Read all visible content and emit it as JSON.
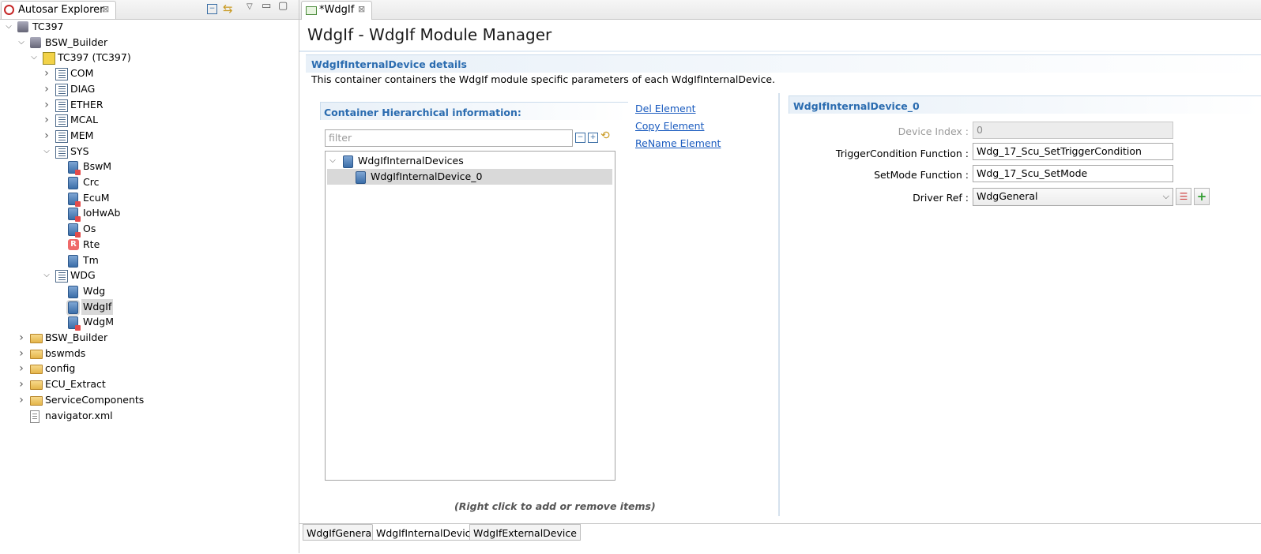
{
  "explorer": {
    "tab_label": "Autosar Explorer",
    "tree": [
      {
        "label": "TC397",
        "level": 0,
        "expanded": "open",
        "icon": "project-icon"
      },
      {
        "label": "BSW_Builder",
        "level": 1,
        "expanded": "open",
        "icon": "builder-icon"
      },
      {
        "label": "TC397 (TC397)",
        "level": 2,
        "expanded": "open",
        "icon": "ecu-chip-icon"
      },
      {
        "label": "COM",
        "level": 3,
        "expanded": "closed",
        "icon": "list-icon"
      },
      {
        "label": "DIAG",
        "level": 3,
        "expanded": "closed",
        "icon": "list-icon"
      },
      {
        "label": "ETHER",
        "level": 3,
        "expanded": "closed",
        "icon": "list-icon"
      },
      {
        "label": "MCAL",
        "level": 3,
        "expanded": "closed",
        "icon": "list-icon"
      },
      {
        "label": "MEM",
        "level": 3,
        "expanded": "closed",
        "icon": "list-icon"
      },
      {
        "label": "SYS",
        "level": 3,
        "expanded": "open",
        "icon": "list-icon"
      },
      {
        "label": "BswM",
        "level": 4,
        "expanded": "none",
        "icon": "module-red-icon"
      },
      {
        "label": "Crc",
        "level": 4,
        "expanded": "none",
        "icon": "module-icon"
      },
      {
        "label": "EcuM",
        "level": 4,
        "expanded": "none",
        "icon": "module-red-icon"
      },
      {
        "label": "IoHwAb",
        "level": 4,
        "expanded": "none",
        "icon": "module-red-icon"
      },
      {
        "label": "Os",
        "level": 4,
        "expanded": "none",
        "icon": "module-red-icon"
      },
      {
        "label": "Rte",
        "level": 4,
        "expanded": "none",
        "icon": "rte-icon"
      },
      {
        "label": "Tm",
        "level": 4,
        "expanded": "none",
        "icon": "module-icon"
      },
      {
        "label": "WDG",
        "level": 3,
        "expanded": "open",
        "icon": "list-icon"
      },
      {
        "label": "Wdg",
        "level": 4,
        "expanded": "none",
        "icon": "module-icon"
      },
      {
        "label": "WdgIf",
        "level": 4,
        "expanded": "none",
        "icon": "module-icon",
        "selected": true
      },
      {
        "label": "WdgM",
        "level": 4,
        "expanded": "none",
        "icon": "module-red-icon"
      },
      {
        "label": "BSW_Builder",
        "level": 1,
        "expanded": "closed",
        "icon": "folder-icon"
      },
      {
        "label": "bswmds",
        "level": 1,
        "expanded": "closed",
        "icon": "folder-icon"
      },
      {
        "label": "config",
        "level": 1,
        "expanded": "closed",
        "icon": "folder-icon"
      },
      {
        "label": "ECU_Extract",
        "level": 1,
        "expanded": "closed",
        "icon": "folder-icon"
      },
      {
        "label": "ServiceComponents",
        "level": 1,
        "expanded": "closed",
        "icon": "folder-icon"
      },
      {
        "label": "navigator.xml",
        "level": 1,
        "expanded": "none",
        "icon": "xml-file-icon"
      }
    ]
  },
  "editor": {
    "tab_label": "*WdgIf",
    "title": "WdgIf - WdgIf Module Manager",
    "section_title": "WdgIfInternalDevice details",
    "section_desc": "This container containers the WdgIf module specific parameters of each WdgIfInternalDevice.",
    "hier_title": "Container Hierarchical information:",
    "filter_placeholder": "filter",
    "hier_tree": [
      {
        "label": "WdgIfInternalDevices",
        "level": 0
      },
      {
        "label": "WdgIfInternalDevice_0",
        "level": 1,
        "selected": true
      }
    ],
    "actions": {
      "del": "Del Element",
      "copy": "Copy Element",
      "rename": "ReName Element"
    },
    "hint": "(Right click to add or remove items)",
    "detail_title": "WdgIfInternalDevice_0",
    "fields": {
      "device_index_label": "Device Index :",
      "device_index_value": "0",
      "trigger_label": "TriggerCondition Function :",
      "trigger_value": "Wdg_17_Scu_SetTriggerCondition",
      "setmode_label": "SetMode Function :",
      "setmode_value": "Wdg_17_Scu_SetMode",
      "driver_label": "Driver Ref :",
      "driver_value": "WdgGeneral"
    },
    "bottom_tabs": [
      "WdgIfGeneral",
      "WdgIfInternalDevice",
      "WdgIfExternalDevice"
    ],
    "active_bottom_tab": "WdgIfInternalDevice"
  }
}
